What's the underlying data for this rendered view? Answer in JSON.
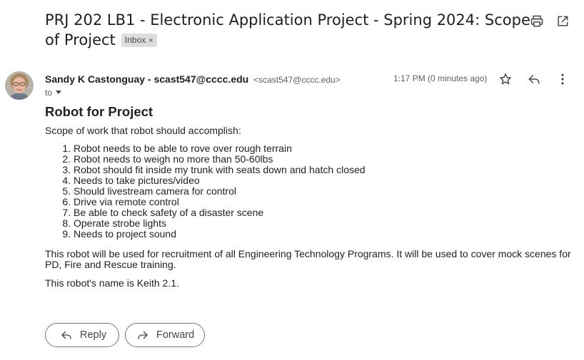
{
  "subject": {
    "title": "PRJ 202 LB1 - Electronic Application Project - Spring 2024: Scope of Project",
    "label_chip": "Inbox",
    "label_chip_remove": "×"
  },
  "toolbar": {
    "print_icon": "printer-icon",
    "popout_icon": "open-in-new-window-icon"
  },
  "message": {
    "sender_name": "Sandy K Castonguay - scast547@cccc.edu",
    "sender_email": "<scast547@cccc.edu>",
    "to_label": "to",
    "time": "1:17 PM (0 minutes ago)",
    "icons": [
      "star-icon",
      "reply-icon",
      "more-vert-icon"
    ]
  },
  "body": {
    "heading": "Robot for Project",
    "intro": "Scope of work that robot should accomplish:",
    "items": [
      "Robot needs to be able to rove over rough terrain",
      "Robot needs to weigh no more than 50-60lbs",
      "Robot should fit inside my trunk with seats down and hatch closed",
      "Needs to take pictures/video",
      "Should livestream camera for control",
      "Drive via remote control",
      "Be able to check safety of a disaster scene",
      "Operate strobe lights",
      "Needs to project sound"
    ],
    "paragraph": "This robot will be used for recruitment of all Engineering Technology Programs. It will be used to cover mock scenes for PD, Fire and Rescue training.",
    "closing": "This robot's name is Keith 2.1."
  },
  "actions": {
    "reply_label": "Reply",
    "forward_label": "Forward"
  },
  "colors": {
    "text": "#1f1f1f",
    "muted": "#5e5e5e",
    "icon": "#444746",
    "chip_bg": "#dddddd"
  }
}
